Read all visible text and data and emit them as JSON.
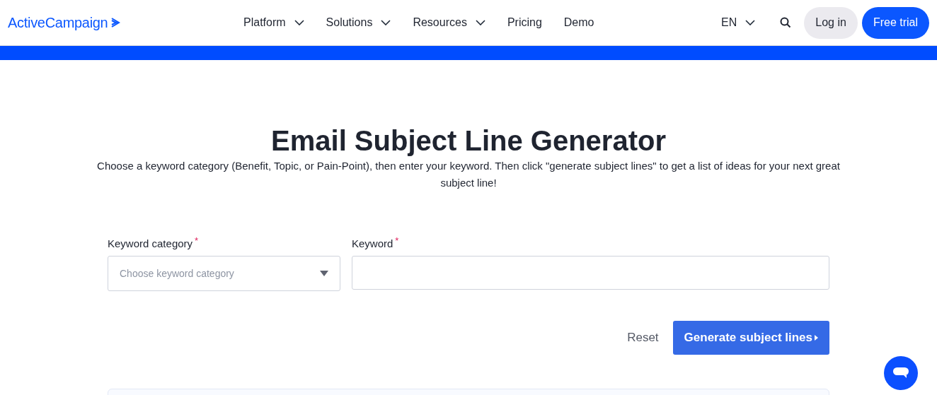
{
  "header": {
    "logo": "ActiveCampaign",
    "nav": [
      {
        "label": "Platform",
        "dropdown": true
      },
      {
        "label": "Solutions",
        "dropdown": true
      },
      {
        "label": "Resources",
        "dropdown": true
      },
      {
        "label": "Pricing",
        "dropdown": false
      },
      {
        "label": "Demo",
        "dropdown": false
      }
    ],
    "language": "EN",
    "login": "Log in",
    "trial": "Free trial"
  },
  "title": "Email Subject Line Generator",
  "description": "Choose a keyword category (Benefit, Topic, or Pain-Point), then enter your keyword. Then click \"generate subject lines\" to get a list of ideas for your next great subject line!",
  "form": {
    "category": {
      "label": "Keyword category",
      "required_mark": "*",
      "placeholder": "Choose keyword category"
    },
    "keyword": {
      "label": "Keyword",
      "required_mark": "*"
    },
    "reset": "Reset",
    "generate": "Generate subject lines"
  }
}
